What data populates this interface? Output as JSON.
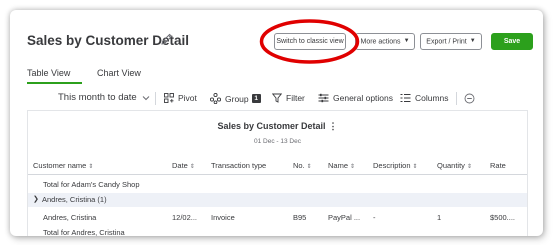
{
  "header": {
    "title": "Sales by Customer Detail",
    "buttons": {
      "classic": "Switch to classic view",
      "more": "More actions",
      "export": "Export / Print",
      "save": "Save"
    }
  },
  "tabs": [
    {
      "label": "Table View",
      "active": true
    },
    {
      "label": "Chart View",
      "active": false
    }
  ],
  "toolbar": {
    "date_range": "This month to date",
    "pivot": "Pivot",
    "group": "Group",
    "group_count": "1",
    "filter": "Filter",
    "general_options": "General options",
    "columns": "Columns"
  },
  "report": {
    "title": "Sales by Customer Detail",
    "menu_glyph": "⋮",
    "subtitle": "01 Dec - 13 Dec",
    "columns": [
      "Customer name",
      "Date",
      "Transaction type",
      "No.",
      "Name",
      "Description",
      "Quantity",
      "Rate"
    ],
    "rows": {
      "total_adams": "Total for Adam's Candy Shop",
      "group_andres": "Andres, Cristina (1)",
      "data_row": {
        "customer": "Andres, Cristina",
        "date": "12/02...",
        "type": "Invoice",
        "no": "B95",
        "name": "PayPal ...",
        "description": "-",
        "quantity": "1",
        "rate": "$500...."
      },
      "total_andres": "Total for Andres, Cristina"
    }
  },
  "colors": {
    "accent_green": "#2ca01c",
    "highlight_red": "#e00000",
    "text": "#393a3d",
    "group_row_bg": "#eef1f7"
  },
  "icons": {
    "edit": "pencil-icon",
    "pivot": "pivot-icon",
    "group": "group-icon",
    "filter": "filter-icon",
    "general": "sliders-icon",
    "columns": "columns-icon",
    "collapse": "collapse-icon"
  }
}
